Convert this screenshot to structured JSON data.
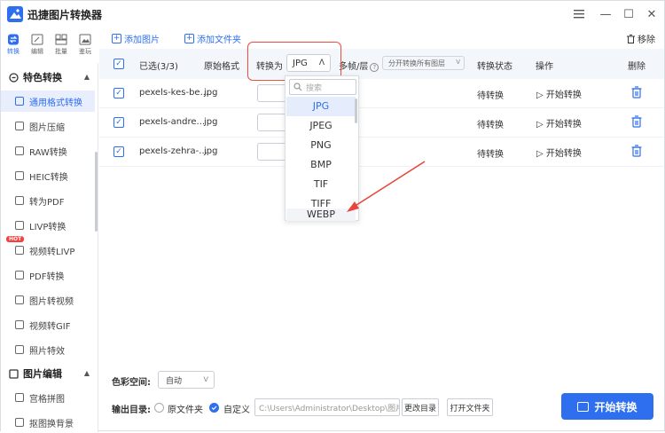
{
  "window": {
    "title": "迅捷图片转换器",
    "min": "—",
    "max": "☐",
    "close": "✕"
  },
  "modes": [
    {
      "label": "转换",
      "icon": "convert-mode-icon",
      "active": true
    },
    {
      "label": "编辑",
      "icon": "edit-mode-icon",
      "active": false
    },
    {
      "label": "批量",
      "icon": "batch-mode-icon",
      "active": false
    },
    {
      "label": "鉴玩",
      "icon": "gallery-mode-icon",
      "active": false
    }
  ],
  "sidebar": {
    "section1": {
      "label": "特色转换",
      "arrow": "▲"
    },
    "items1": [
      {
        "label": "通用格式转换",
        "active": true
      },
      {
        "label": "图片压缩"
      },
      {
        "label": "RAW转换"
      },
      {
        "label": "HEIC转换"
      },
      {
        "label": "转为PDF"
      },
      {
        "label": "LIVP转换"
      },
      {
        "label": "视频转LIVP",
        "badge": "HOT"
      },
      {
        "label": "PDF转换"
      },
      {
        "label": "图片转视频"
      },
      {
        "label": "视频转GIF"
      },
      {
        "label": "照片特效"
      }
    ],
    "section2": {
      "label": "图片编辑",
      "arrow": "▲"
    },
    "items2": [
      {
        "label": "宫格拼图"
      },
      {
        "label": "抠图换背景"
      }
    ]
  },
  "toolbar": {
    "add_image": "添加图片",
    "add_folder": "添加文件夹",
    "remove": "移除"
  },
  "table": {
    "headers": {
      "selected": "已选(3/3)",
      "orig_format": "原始格式",
      "convert_to": "转换为",
      "multi_frame": "多帧/层",
      "layer_mode": "分开转换所有图层",
      "status": "转换状态",
      "action": "操作",
      "delete": "删除"
    },
    "format_selected": "JPG",
    "format_chevron": "ᐱ",
    "rows": [
      {
        "name": "pexels-kes-be...",
        "format": "jpg",
        "status": "待转换",
        "action": "开始转换"
      },
      {
        "name": "pexels-andre...",
        "format": "jpg",
        "status": "待转换",
        "action": "开始转换"
      },
      {
        "name": "pexels-zehra-...",
        "format": "jpg",
        "status": "待转换",
        "action": "开始转换"
      }
    ]
  },
  "dropdown": {
    "search_placeholder": "搜索",
    "options": [
      "JPG",
      "JPEG",
      "PNG",
      "BMP",
      "TIF",
      "TIFF",
      "WEBP"
    ],
    "selected_index": 0
  },
  "footer": {
    "color_space_label": "色彩空间:",
    "color_space_value": "自动",
    "output_label": "输出目录:",
    "opt_original": "原文件夹",
    "opt_custom": "自定义",
    "path": "C:\\Users\\Administrator\\Desktop\\图片",
    "change_dir": "更改目录",
    "open_folder": "打开文件夹",
    "convert_button": "开始转换"
  },
  "colors": {
    "accent": "#2e6ff0",
    "highlight": "#f24a3e"
  }
}
